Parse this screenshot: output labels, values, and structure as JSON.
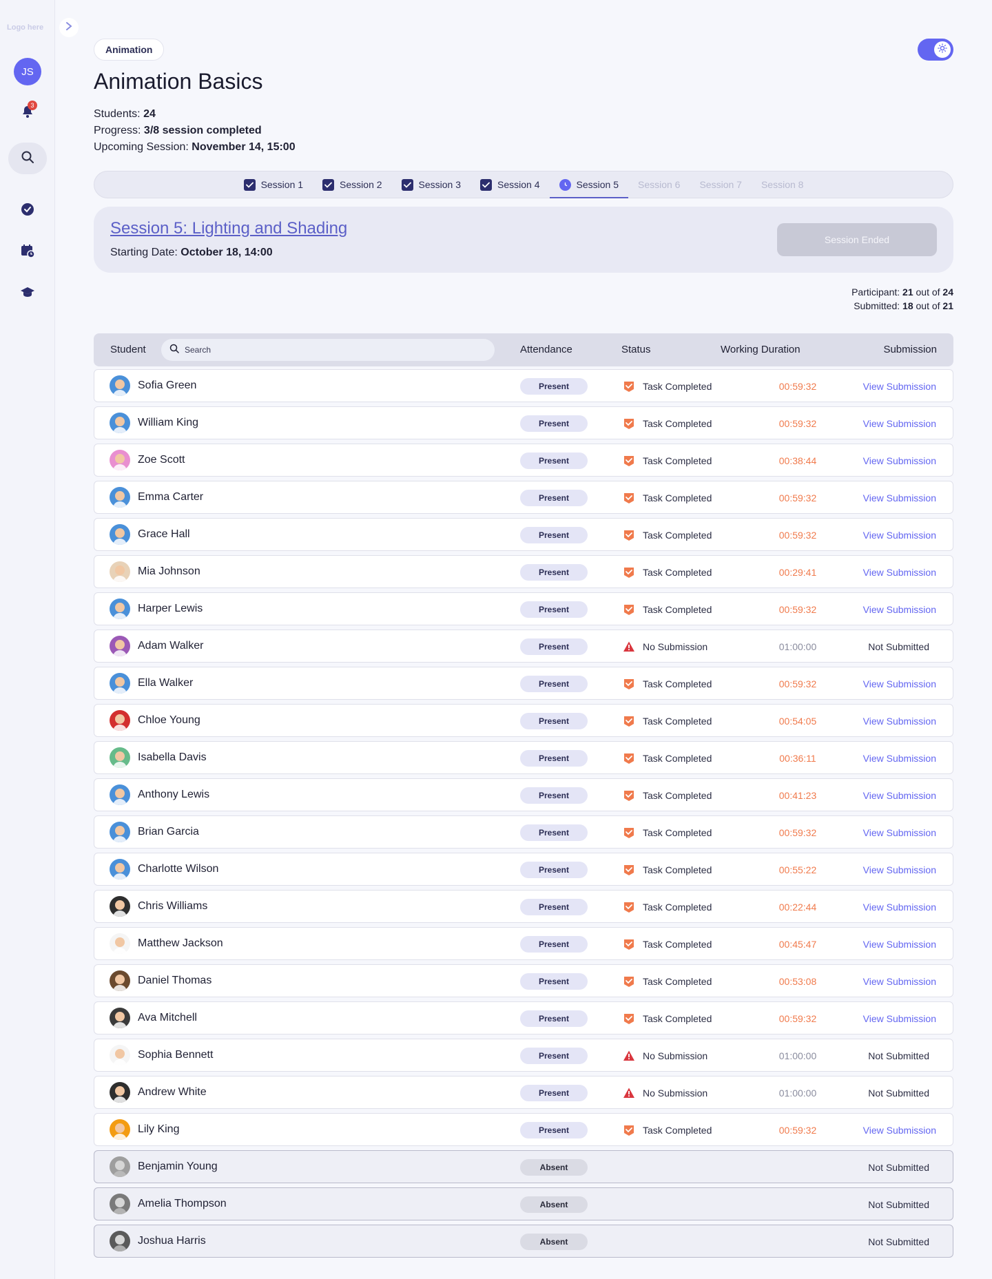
{
  "sidebar": {
    "logo": "Logo here",
    "user_initials": "JS",
    "notification_count": "3"
  },
  "header": {
    "category": "Animation",
    "title": "Animation Basics",
    "students_label": "Students:",
    "students_value": "24",
    "progress_label": "Progress:",
    "progress_value": "3/8 session completed",
    "upcoming_label": "Upcoming Session:",
    "upcoming_value": "November 14, 15:00"
  },
  "tabs": [
    {
      "label": "Session 1",
      "state": "done"
    },
    {
      "label": "Session 2",
      "state": "done"
    },
    {
      "label": "Session 3",
      "state": "done"
    },
    {
      "label": "Session 4",
      "state": "done"
    },
    {
      "label": "Session 5",
      "state": "active"
    },
    {
      "label": "Session 6",
      "state": "disabled"
    },
    {
      "label": "Session 7",
      "state": "disabled"
    },
    {
      "label": "Session 8",
      "state": "disabled"
    }
  ],
  "session": {
    "title": "Session 5: Lighting and Shading",
    "date_label": "Starting Date:",
    "date_value": "October 18, 14:00",
    "button_label": "Session Ended"
  },
  "stats": {
    "participant_label": "Participant:",
    "participant_value": "21",
    "participant_total": "24",
    "submitted_label": "Submitted:",
    "submitted_value": "18",
    "submitted_total": "21",
    "out_of": "out of"
  },
  "table": {
    "col_student": "Student",
    "search_placeholder": "Search",
    "col_attendance": "Attendance",
    "col_status": "Status",
    "col_duration": "Working Duration",
    "col_submission": "Submission"
  },
  "students": [
    {
      "name": "Sofia Green",
      "attendance": "Present",
      "status": "Task Completed",
      "duration": "00:59:32",
      "submission": "View Submission",
      "avatar_color": "#4a90d9"
    },
    {
      "name": "William King",
      "attendance": "Present",
      "status": "Task Completed",
      "duration": "00:59:32",
      "submission": "View Submission",
      "avatar_color": "#4a90d9"
    },
    {
      "name": "Zoe Scott",
      "attendance": "Present",
      "status": "Task Completed",
      "duration": "00:38:44",
      "submission": "View Submission",
      "avatar_color": "#e98fd0"
    },
    {
      "name": "Emma Carter",
      "attendance": "Present",
      "status": "Task Completed",
      "duration": "00:59:32",
      "submission": "View Submission",
      "avatar_color": "#4a90d9"
    },
    {
      "name": "Grace Hall",
      "attendance": "Present",
      "status": "Task Completed",
      "duration": "00:59:32",
      "submission": "View Submission",
      "avatar_color": "#4a90d9"
    },
    {
      "name": "Mia Johnson",
      "attendance": "Present",
      "status": "Task Completed",
      "duration": "00:29:41",
      "submission": "View Submission",
      "avatar_color": "#e8d2b8"
    },
    {
      "name": "Harper Lewis",
      "attendance": "Present",
      "status": "Task Completed",
      "duration": "00:59:32",
      "submission": "View Submission",
      "avatar_color": "#4a90d9"
    },
    {
      "name": "Adam Walker",
      "attendance": "Present",
      "status": "No Submission",
      "duration": "01:00:00",
      "submission": "Not Submitted",
      "avatar_color": "#9b59b6"
    },
    {
      "name": "Ella Walker",
      "attendance": "Present",
      "status": "Task Completed",
      "duration": "00:59:32",
      "submission": "View Submission",
      "avatar_color": "#4a90d9"
    },
    {
      "name": "Chloe Young",
      "attendance": "Present",
      "status": "Task Completed",
      "duration": "00:54:05",
      "submission": "View Submission",
      "avatar_color": "#d32f2f"
    },
    {
      "name": "Isabella Davis",
      "attendance": "Present",
      "status": "Task Completed",
      "duration": "00:36:11",
      "submission": "View Submission",
      "avatar_color": "#66bb8a"
    },
    {
      "name": "Anthony Lewis",
      "attendance": "Present",
      "status": "Task Completed",
      "duration": "00:41:23",
      "submission": "View Submission",
      "avatar_color": "#4a90d9"
    },
    {
      "name": "Brian Garcia",
      "attendance": "Present",
      "status": "Task Completed",
      "duration": "00:59:32",
      "submission": "View Submission",
      "avatar_color": "#4a90d9"
    },
    {
      "name": "Charlotte Wilson",
      "attendance": "Present",
      "status": "Task Completed",
      "duration": "00:55:22",
      "submission": "View Submission",
      "avatar_color": "#4a90d9"
    },
    {
      "name": "Chris Williams",
      "attendance": "Present",
      "status": "Task Completed",
      "duration": "00:22:44",
      "submission": "View Submission",
      "avatar_color": "#2e2e2e"
    },
    {
      "name": "Matthew Jackson",
      "attendance": "Present",
      "status": "Task Completed",
      "duration": "00:45:47",
      "submission": "View Submission",
      "avatar_color": "#f5f5f5"
    },
    {
      "name": "Daniel Thomas",
      "attendance": "Present",
      "status": "Task Completed",
      "duration": "00:53:08",
      "submission": "View Submission",
      "avatar_color": "#6b4a2e"
    },
    {
      "name": "Ava Mitchell",
      "attendance": "Present",
      "status": "Task Completed",
      "duration": "00:59:32",
      "submission": "View Submission",
      "avatar_color": "#3a3a3a"
    },
    {
      "name": "Sophia Bennett",
      "attendance": "Present",
      "status": "No Submission",
      "duration": "01:00:00",
      "submission": "Not Submitted",
      "avatar_color": "#f5f5f5"
    },
    {
      "name": "Andrew White",
      "attendance": "Present",
      "status": "No Submission",
      "duration": "01:00:00",
      "submission": "Not Submitted",
      "avatar_color": "#2e2e2e"
    },
    {
      "name": "Lily King",
      "attendance": "Present",
      "status": "Task Completed",
      "duration": "00:59:32",
      "submission": "View Submission",
      "avatar_color": "#f39c12"
    },
    {
      "name": "Benjamin Young",
      "attendance": "Absent",
      "status": "",
      "duration": "",
      "submission": "Not Submitted",
      "avatar_color": "#9e9e9e"
    },
    {
      "name": "Amelia Thompson",
      "attendance": "Absent",
      "status": "",
      "duration": "",
      "submission": "Not Submitted",
      "avatar_color": "#7a7a7a"
    },
    {
      "name": "Joshua Harris",
      "attendance": "Absent",
      "status": "",
      "duration": "",
      "submission": "Not Submitted",
      "avatar_color": "#5a5a5a"
    }
  ],
  "colors": {
    "accent": "#6366f1",
    "duration_ok": "#f07a4c",
    "status_completed": "#f07a4c",
    "status_warning": "#d9363e"
  },
  "icons": {
    "collapse": "chevron-right-icon",
    "notifications": "bell-icon",
    "search": "search-icon",
    "tasks": "check-circle-icon",
    "schedule": "calendar-clock-icon",
    "courses": "graduation-cap-icon",
    "theme": "sun-icon",
    "completed": "check-badge-icon",
    "no_submission": "warning-triangle-icon"
  }
}
